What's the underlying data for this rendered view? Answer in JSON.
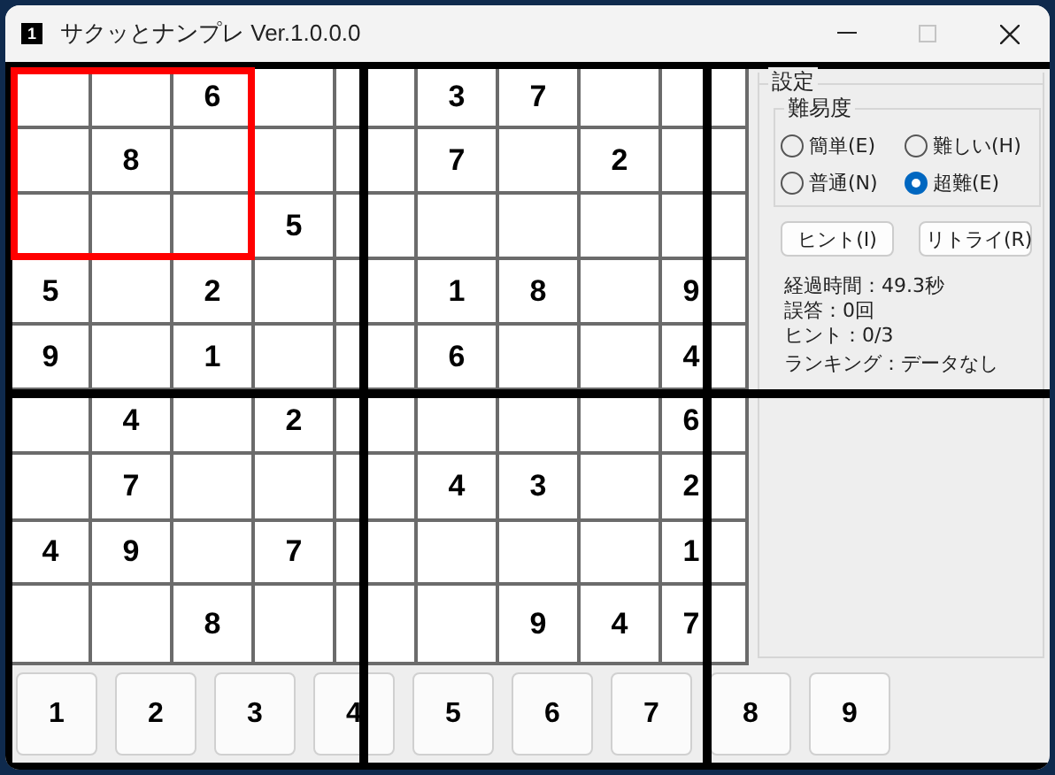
{
  "window": {
    "title": "サクッとナンプレ Ver.1.0.0.0",
    "icon_text": "1",
    "controls": [
      {
        "kind": "minimize",
        "disabled": false
      },
      {
        "kind": "maximize",
        "disabled": true
      },
      {
        "kind": "close",
        "disabled": false
      }
    ]
  },
  "board": {
    "blocks": [
      {
        "selected": true,
        "cells": [
          {},
          {},
          {
            "value": "6"
          },
          {},
          {
            "value": "8"
          },
          {},
          {},
          {},
          {}
        ]
      },
      {
        "selected": false,
        "cells": [
          {},
          {},
          {
            "value": "3"
          },
          {},
          {},
          {
            "value": "7"
          },
          {
            "value": "5"
          },
          {},
          {}
        ]
      },
      {
        "selected": false,
        "cells": [
          {
            "value": "7"
          },
          {},
          {},
          {},
          {
            "value": "2"
          },
          {},
          {},
          {},
          {}
        ]
      },
      {
        "selected": false,
        "cells": [
          {
            "value": "5"
          },
          {},
          {
            "value": "2"
          },
          {
            "value": "9"
          },
          {},
          {
            "value": "1"
          },
          {},
          {
            "value": "4"
          },
          {}
        ]
      },
      {
        "selected": false,
        "cells": [
          {},
          {},
          {
            "value": "1"
          },
          {},
          {},
          {
            "value": "6"
          },
          {
            "value": "2"
          },
          {},
          {}
        ]
      },
      {
        "selected": false,
        "cells": [
          {
            "value": "8"
          },
          {},
          {
            "value": "9"
          },
          {},
          {},
          {
            "value": "4"
          },
          {},
          {},
          {
            "value": "6"
          }
        ]
      },
      {
        "selected": false,
        "cells": [
          {},
          {
            "value": "7"
          },
          {},
          {
            "value": "4"
          },
          {
            "value": "9"
          },
          {},
          {},
          {},
          {
            "value": "8"
          }
        ]
      },
      {
        "selected": false,
        "cells": [
          {},
          {},
          {
            "value": "4"
          },
          {
            "value": "7"
          },
          {},
          {},
          {},
          {},
          {}
        ]
      },
      {
        "selected": false,
        "cells": [
          {
            "value": "3"
          },
          {},
          {
            "value": "2"
          },
          {},
          {},
          {
            "value": "1"
          },
          {
            "value": "9"
          },
          {
            "value": "4"
          },
          {
            "value": "7"
          }
        ]
      }
    ]
  },
  "settings": {
    "title": "設定",
    "difficulty": {
      "title": "難易度",
      "options": [
        {
          "label": "簡単(E)",
          "selected": false
        },
        {
          "label": "難しい(H)",
          "selected": false
        },
        {
          "label": "普通(N)",
          "selected": false
        },
        {
          "label": "超難(E)",
          "selected": true
        }
      ]
    },
    "buttons": [
      "ヒント(I)",
      "リトライ(R)"
    ],
    "stats": [
      "経過時間：49.3秒",
      "誤答：0回",
      "ヒント：0/3"
    ],
    "ranking": "ランキング：データなし"
  },
  "number_pad": [
    "1",
    "2",
    "3",
    "4",
    "5",
    "6",
    "7",
    "8",
    "9"
  ]
}
